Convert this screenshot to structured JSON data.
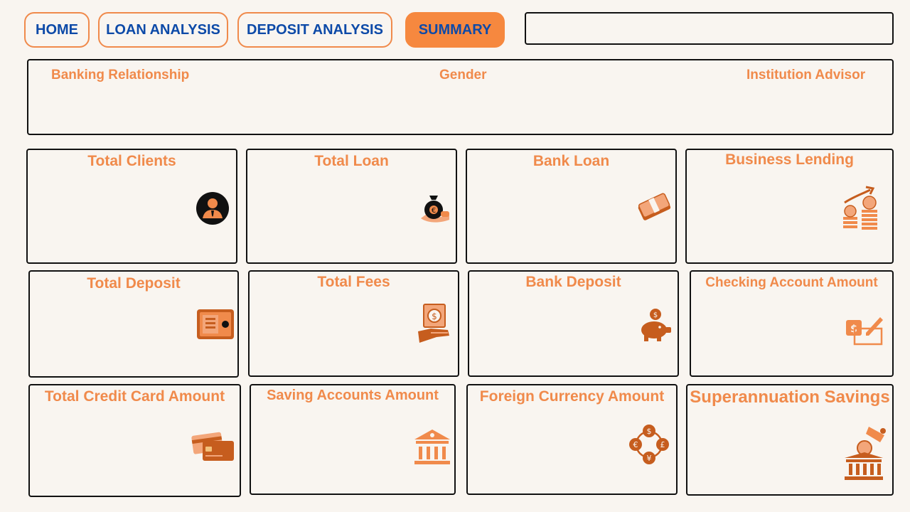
{
  "nav": {
    "home": "HOME",
    "loan_analysis": "LOAN ANALYSIS",
    "deposit_analysis": "DEPOSIT ANALYSIS",
    "summary": "SUMMARY"
  },
  "search": {
    "value": ""
  },
  "filters": {
    "banking_relationship": "Banking Relationship",
    "gender": "Gender",
    "institution_advisor": "Institution Advisor"
  },
  "cards": {
    "total_clients": "Total Clients",
    "total_loan": "Total Loan",
    "bank_loan": "Bank Loan",
    "business_lending": "Business Lending",
    "total_deposit": "Total Deposit",
    "total_fees": "Total Fees",
    "bank_deposit": "Bank Deposit",
    "checking_account_amount": "Checking Account Amount",
    "total_credit_card_amount": "Total Credit Card Amount",
    "saving_accounts_amount": "Saving Accounts Amount",
    "foreign_currency_amount": "Foreign Currency Amount",
    "superannuation_savings": "Superannuation Savings"
  },
  "icons": {
    "total_clients": "client-person-icon",
    "total_loan": "money-bag-hand-icon",
    "bank_loan": "cash-stack-icon",
    "business_lending": "coin-growth-icon",
    "total_deposit": "safe-icon",
    "total_fees": "hand-money-icon",
    "bank_deposit": "piggy-bank-icon",
    "checking_account_amount": "check-pen-icon",
    "total_credit_card_amount": "credit-cards-icon",
    "saving_accounts_amount": "bank-building-icon",
    "foreign_currency_amount": "currency-exchange-icon",
    "superannuation_savings": "coin-deposit-box-icon"
  },
  "colors": {
    "accent": "#f08a4b",
    "nav_text": "#0d4aa8",
    "background": "#f9f5f0"
  }
}
